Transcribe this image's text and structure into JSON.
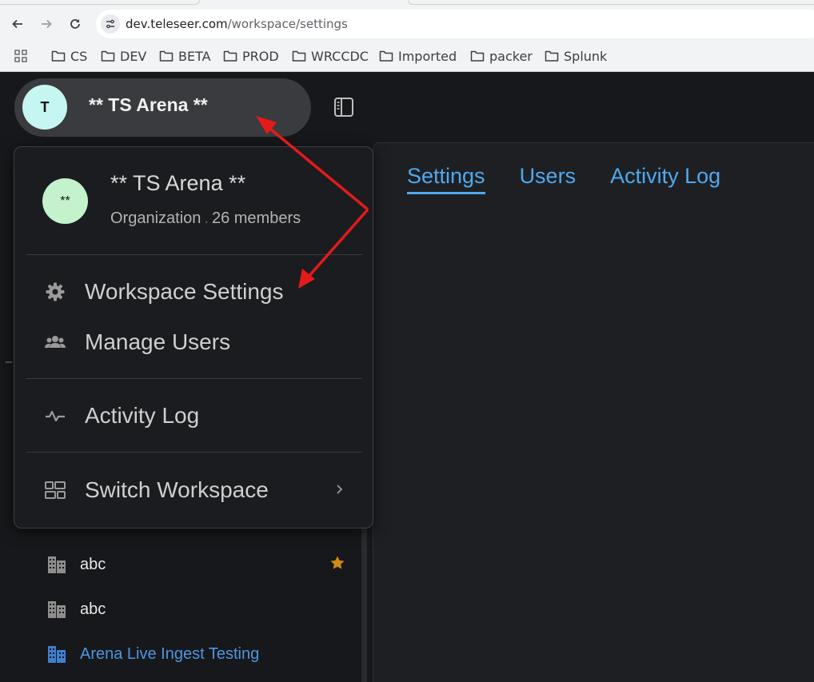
{
  "browser": {
    "url_host": "dev.teleseer.com",
    "url_path": "/workspace/settings",
    "bookmarks": [
      {
        "label": "CS",
        "icon": "folder-icon"
      },
      {
        "label": "DEV",
        "icon": "folder-icon"
      },
      {
        "label": "BETA",
        "icon": "folder-icon"
      },
      {
        "label": "PROD",
        "icon": "folder-icon"
      },
      {
        "label": "WRCCDC",
        "icon": "folder-icon"
      },
      {
        "label": "Imported",
        "icon": "folder-icon"
      },
      {
        "label": "packer",
        "icon": "folder-icon"
      },
      {
        "label": "Splunk",
        "icon": "folder-icon"
      }
    ]
  },
  "workspace": {
    "avatar_letter": "T",
    "name": "** TS Arena **",
    "avatar_color": "#c6f6f1"
  },
  "tabs": [
    {
      "label": "Settings",
      "active": true
    },
    {
      "label": "Users",
      "active": false
    },
    {
      "label": "Activity Log",
      "active": false
    }
  ],
  "menu": {
    "avatar_text": "**",
    "avatar_color": "#c3f2cd",
    "title": "** TS Arena **",
    "type": "Organization",
    "separator": ".",
    "members": "26 members",
    "items": [
      {
        "label": "Workspace Settings",
        "icon": "gear-icon"
      },
      {
        "label": "Manage Users",
        "icon": "users-icon"
      },
      {
        "label": "Activity Log",
        "icon": "activity-icon"
      },
      {
        "label": "Switch Workspace",
        "icon": "workspaces-icon"
      }
    ]
  },
  "sidebar": {
    "workspaces": [
      {
        "label": "abc",
        "icon": "building-icon",
        "starred": true
      },
      {
        "label": "abc",
        "icon": "building-icon",
        "starred": false
      },
      {
        "label": "Arena Live Ingest Testing",
        "icon": "building-icon",
        "active": true
      }
    ]
  },
  "colors": {
    "accent": "#4fa9ef",
    "annotation_arrow": "#e31b1b",
    "star": "#d08a16"
  }
}
